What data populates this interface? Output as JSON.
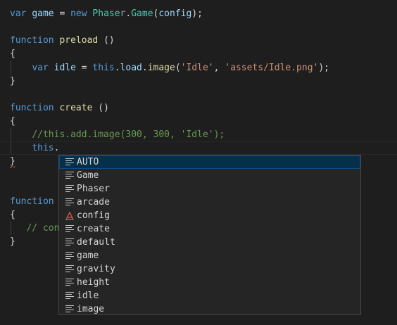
{
  "code": {
    "l1": {
      "kw_var": "var",
      "name": "game",
      "eq": " = ",
      "kw_new": "new",
      "cls": "Phaser",
      "dot": ".",
      "ctor": "Game",
      "open": "(",
      "arg": "config",
      "close": ");"
    },
    "l3": {
      "kw": "function",
      "name": "preload",
      "tail": " ()"
    },
    "l4": "{",
    "l5": {
      "kw": "var",
      "name": "idle",
      "eq": " = ",
      "this": "this",
      "d1": ".",
      "load": "load",
      "d2": ".",
      "image": "image",
      "open": "(",
      "s1": "'Idle'",
      "comma": ", ",
      "s2": "'assets/Idle.png'",
      "close": ");"
    },
    "l6": "}",
    "l8": {
      "kw": "function",
      "name": "create",
      "tail": " ()"
    },
    "l9": "{",
    "l10": "//this.add.image(300, 300, 'Idle');",
    "l11": {
      "this": "this",
      "dot": "."
    },
    "l12": "}",
    "l15": {
      "kw": "function"
    },
    "l16": "{",
    "l17": "// con",
    "l18": "}"
  },
  "suggest": {
    "items": [
      {
        "label": "AUTO",
        "kind": "text",
        "selected": true
      },
      {
        "label": "Game",
        "kind": "text"
      },
      {
        "label": "Phaser",
        "kind": "text"
      },
      {
        "label": "arcade",
        "kind": "text"
      },
      {
        "label": "config",
        "kind": "snippet"
      },
      {
        "label": "create",
        "kind": "text"
      },
      {
        "label": "default",
        "kind": "text"
      },
      {
        "label": "game",
        "kind": "text"
      },
      {
        "label": "gravity",
        "kind": "text"
      },
      {
        "label": "height",
        "kind": "text"
      },
      {
        "label": "idle",
        "kind": "text"
      },
      {
        "label": "image",
        "kind": "text"
      }
    ]
  },
  "colors": {
    "background": "#1e1e1e",
    "keyword": "#569cd6",
    "variable": "#9cdcfe",
    "function": "#dcdcaa",
    "class": "#4ec9b0",
    "string": "#ce9178",
    "comment": "#6a9955",
    "selection": "#062f4a"
  }
}
